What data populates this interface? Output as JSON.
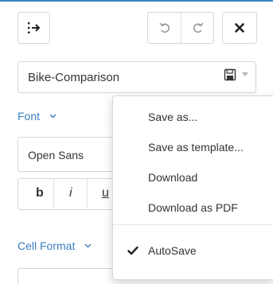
{
  "document": {
    "name": "Bike-Comparison"
  },
  "sections": {
    "font": "Font",
    "cell_format": "Cell Format"
  },
  "font": {
    "family": "Open Sans"
  },
  "text_styles": {
    "bold": "b",
    "italic": "i",
    "underline": "u"
  },
  "save_menu": {
    "items": [
      {
        "label": "Save as...",
        "checked": false
      },
      {
        "label": "Save as template...",
        "checked": false
      },
      {
        "label": "Download",
        "checked": false
      },
      {
        "label": "Download as PDF",
        "checked": false
      },
      {
        "label": "AutoSave",
        "checked": true
      }
    ]
  },
  "icons": {
    "collapse": "arrow-to-right-icon",
    "undo": "undo-icon",
    "redo": "redo-icon",
    "close": "close-icon",
    "save": "floppy-disk-icon",
    "dropdown": "caret-down-icon",
    "section_expand": "chevron-down-icon",
    "checked": "check-icon"
  },
  "colors": {
    "accent": "#3a7fc0",
    "top_border": "#3b82c4",
    "text": "#333333",
    "border": "#d6d6d6"
  }
}
